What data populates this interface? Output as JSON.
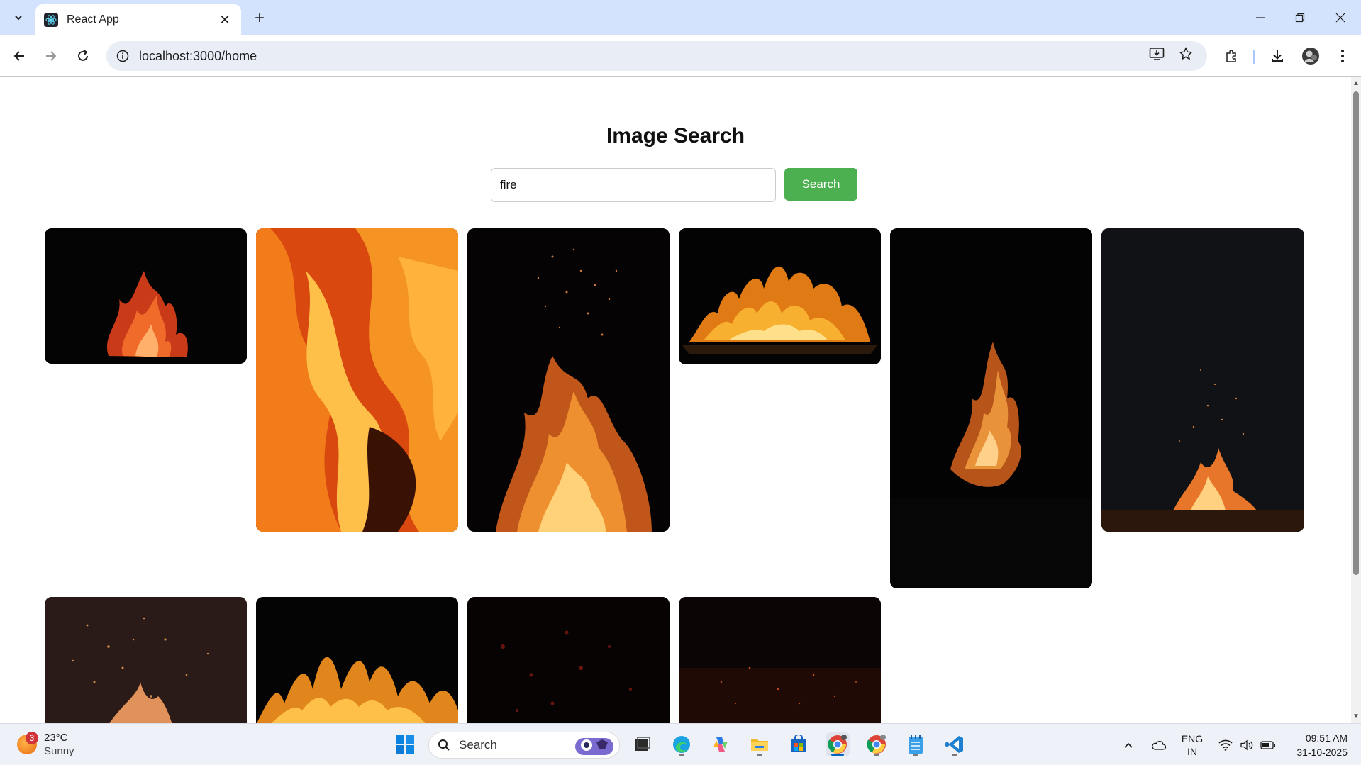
{
  "browser": {
    "tab_title": "React App",
    "url": "localhost:3000/home"
  },
  "page": {
    "title": "Image Search",
    "search_value": "fire",
    "search_button": "Search",
    "images": [
      {
        "name": "campfire-small-red-flames"
      },
      {
        "name": "orange-flame-closeup"
      },
      {
        "name": "flames-with-sparks"
      },
      {
        "name": "wide-flame-on-grate"
      },
      {
        "name": "tall-bonfire-flame"
      },
      {
        "name": "distant-bonfire-sparks"
      },
      {
        "name": "glowing-embers-sparks"
      },
      {
        "name": "row-of-flames"
      },
      {
        "name": "dark-red-bokeh-embers"
      },
      {
        "name": "floating-embers-dark"
      }
    ]
  },
  "taskbar": {
    "weather_temp": "23°C",
    "weather_desc": "Sunny",
    "weather_badge": "3",
    "search_label": "Search",
    "lang_line1": "ENG",
    "lang_line2": "IN",
    "time": "09:51 AM",
    "date": "31-10-2025"
  },
  "colors": {
    "titlebar_bg": "#d3e3fd",
    "omnibox_bg": "#e9eef6",
    "search_button_bg": "#4caf50",
    "taskbar_bg": "#eef1f7"
  }
}
